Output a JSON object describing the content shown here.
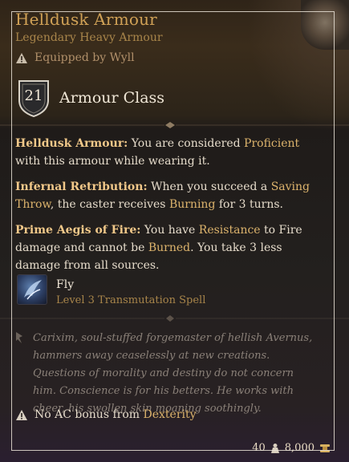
{
  "item": {
    "title": "Helldusk Armour",
    "subtitle": "Legendary Heavy Armour",
    "equipped": "Equipped by Wyll",
    "armour_class_value": "21",
    "armour_class_label": "Armour Class"
  },
  "properties": [
    {
      "name": "Helldusk Armour:",
      "t1": "You are considered ",
      "h1": "Proficient",
      "t2": " with this armour while wearing it."
    },
    {
      "name": "Infernal Retribution:",
      "t1": "When you succeed a ",
      "h1": "Saving Throw",
      "t2": ", the caster receives ",
      "h2": "Burning",
      "t3": " for 3 turns."
    },
    {
      "name": "Prime Aegis of Fire:",
      "t1": "You have ",
      "h1": "Resistance",
      "t2": " to Fire damage and cannot be ",
      "h2": "Burned",
      "t3": ". You take 3 less damage from all sources."
    }
  ],
  "spell": {
    "name": "Fly",
    "detail": "Level 3 Transmutation Spell",
    "icon": "fly-spell-icon"
  },
  "lore": "Carixim, soul-stuffed forgemaster of hellish Avernus, hammers away ceaselessly at new creations. Questions of morality and destiny do not concern him. Conscience is for his betters. He works with cheer, his swollen skin moaning soothingly.",
  "warning": {
    "t1": "No AC bonus from ",
    "h1": "Dexterity"
  },
  "footer": {
    "weight": "40",
    "value": "8,000"
  },
  "colors": {
    "title": "#d0a156",
    "highlight": "#dcb36c",
    "frame": "#e9e2d6"
  }
}
